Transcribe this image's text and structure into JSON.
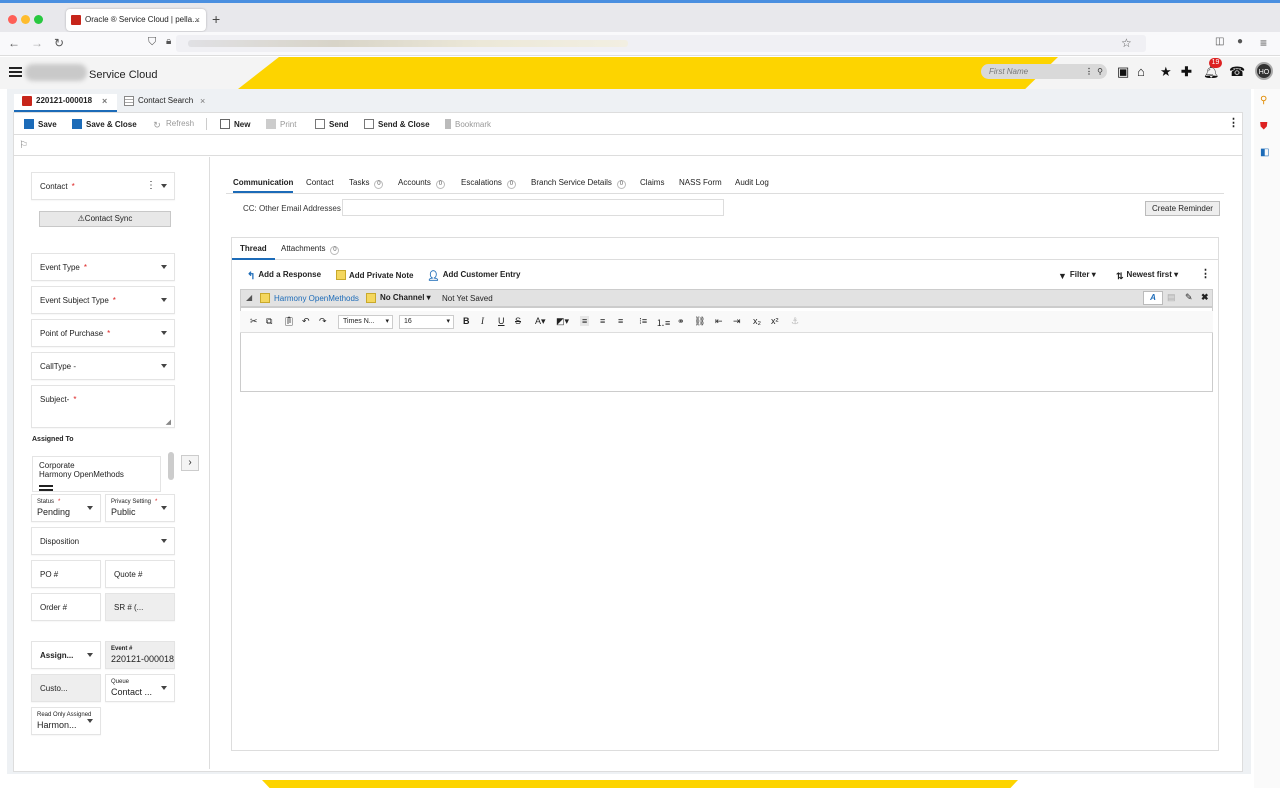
{
  "browser": {
    "tab_title": "Oracle ® Service Cloud | pella...",
    "tab_close": "×",
    "new_tab": "+"
  },
  "header": {
    "app_name": "Service Cloud",
    "search_placeholder": "First Name",
    "notification_count": "19",
    "avatar_initials": "HO"
  },
  "workspace_tabs": [
    {
      "label": "220121-000018",
      "close": "×"
    },
    {
      "label": "Contact Search",
      "close": "×"
    }
  ],
  "toolbar": {
    "save": "Save",
    "save_close": "Save & Close",
    "refresh": "Refresh",
    "new": "New",
    "print": "Print",
    "send": "Send",
    "send_close": "Send & Close",
    "bookmark": "Bookmark"
  },
  "form": {
    "contact": "Contact",
    "contact_sync": "Contact Sync",
    "event_type": "Event Type",
    "event_subject_type": "Event Subject Type",
    "point_of_purchase": "Point of Purchase",
    "call_type": "CallType -",
    "subject": "Subject-",
    "required_mark": "*",
    "assigned_to": "Assigned To",
    "assigned_line1": "Corporate",
    "assigned_line2": "Harmony OpenMethods",
    "status_label": "Status",
    "status_value": "Pending",
    "privacy_label": "Privacy Setting",
    "privacy_value": "Public",
    "disposition": "Disposition",
    "po": "PO #",
    "quote": "Quote #",
    "order": "Order #",
    "sr": "SR # (...",
    "assign_short": "Assign...",
    "event_num_label": "Event #",
    "event_num_value": "220121-000018",
    "custo": "Custo...",
    "queue_label": "Queue",
    "queue_value": "Contact ...",
    "read_only_label": "Read Only Assigned",
    "read_only_value": "Harmon..."
  },
  "content_tabs": [
    {
      "label": "Communication",
      "count": ""
    },
    {
      "label": "Contact",
      "count": ""
    },
    {
      "label": "Tasks",
      "count": "0"
    },
    {
      "label": "Accounts",
      "count": "0"
    },
    {
      "label": "Escalations",
      "count": "0"
    },
    {
      "label": "Branch Service Details",
      "count": "0"
    },
    {
      "label": "Claims",
      "count": ""
    },
    {
      "label": "NASS Form",
      "count": ""
    },
    {
      "label": "Audit Log",
      "count": ""
    }
  ],
  "cc_label": "CC: Other Email Addresses",
  "create_reminder": "Create Reminder",
  "thread_tabs": [
    {
      "label": "Thread",
      "count": ""
    },
    {
      "label": "Attachments",
      "count": "0"
    }
  ],
  "thread_actions": {
    "add_response": "Add a Response",
    "add_note": "Add Private Note",
    "add_customer": "Add Customer Entry",
    "filter": "Filter",
    "sort": "Newest first"
  },
  "entry": {
    "author": "Harmony OpenMethods",
    "channel": "No Channel",
    "status": "Not Yet Saved"
  },
  "editor": {
    "font": "Times N...",
    "size": "16"
  },
  "colors": {
    "accent": "#1c6bb8",
    "brand_yellow": "#fdd400",
    "required": "#dd2222"
  }
}
